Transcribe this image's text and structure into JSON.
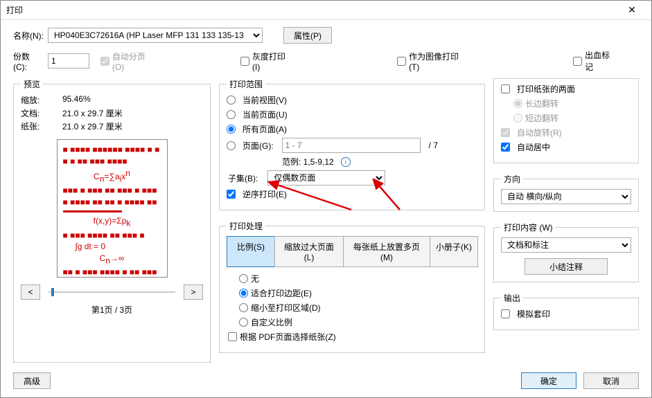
{
  "title": "打印",
  "top": {
    "name_lbl": "名称(N):",
    "printer": "HP040E3C72616A (HP Laser MFP 131 133 135-13",
    "props_btn": "属性(P)",
    "copies_lbl": "份数(C):",
    "copies_val": "1",
    "collate": "自动分页(O)",
    "gray": "灰度打印(I)",
    "as_image": "作为图像打印(T)",
    "bleed": "出血标记"
  },
  "preview": {
    "legend": "预览",
    "zoom_lbl": "缩放:",
    "zoom_val": "95.46%",
    "doc_lbl": "文档:",
    "doc_val": "21.0 x 29.7 厘米",
    "paper_lbl": "纸张:",
    "paper_val": "21.0 x 29.7 厘米",
    "pager": "第1页 / 3页"
  },
  "range": {
    "legend": "打印范围",
    "curview": "当前视图(V)",
    "curpage": "当前页面(U)",
    "allpages": "所有页面(A)",
    "pages": "页面(G):",
    "pages_ph": "1 - 7",
    "total": "/ 7",
    "example_lbl": "范例: 1,5-9,12",
    "subset_lbl": "子集(B):",
    "subset_val": "仅偶数页面",
    "reverse": "逆序打印(E)"
  },
  "handling": {
    "legend": "打印处理",
    "t_scale": "比例(S)",
    "t_big": "缩放过大页面(L)",
    "t_multi": "每张纸上放置多页(M)",
    "t_booklet": "小册子(K)",
    "none": "无",
    "fit": "适合打印边距(E)",
    "shrink": "缩小至打印区域(D)",
    "custom": "自定义比例",
    "choose_paper": "根据 PDF页面选择纸张(Z)"
  },
  "right": {
    "duplex": "打印纸张的两面",
    "flip_long": "长边翻转",
    "flip_short": "短边翻转",
    "autorotate": "自动旋转(R)",
    "autocenter": "自动居中",
    "orient_lbl": "方向",
    "orient_val": "自动 横向/纵向",
    "content_lbl": "打印内容 (W)",
    "content_val": "文档和标注",
    "summary_btn": "小结注释",
    "output_lbl": "输出",
    "overprint": "模拟套印"
  },
  "btm": {
    "adv": "高级",
    "ok": "确定",
    "cancel": "取消"
  }
}
